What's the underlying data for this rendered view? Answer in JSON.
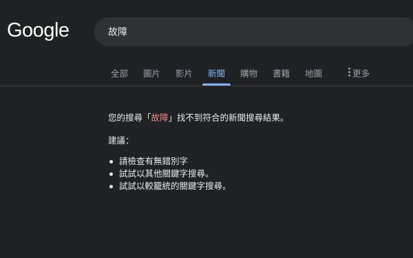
{
  "logo": {
    "text": "Google"
  },
  "search": {
    "value": "故障"
  },
  "tabs": [
    {
      "label": "全部"
    },
    {
      "label": "圖片"
    },
    {
      "label": "影片"
    },
    {
      "label": "新聞",
      "active": true
    },
    {
      "label": "購物"
    },
    {
      "label": "書籍"
    },
    {
      "label": "地圖"
    }
  ],
  "more_label": "更多",
  "no_results": {
    "prefix": "您的搜尋「",
    "query": "故障",
    "suffix": "」找不到符合的新聞搜尋結果。"
  },
  "suggestions": {
    "title": "建議：",
    "items": [
      "請檢查有無錯別字",
      "試試以其他關鍵字搜尋。",
      "試試以較籠統的關鍵字搜尋。"
    ]
  },
  "colors": {
    "background": "#202124",
    "search_box": "#303134",
    "active_tab": "#8ab4f8",
    "query_highlight": "#f28b82",
    "text": "#e8eaed",
    "muted_text": "#9aa0a6"
  }
}
